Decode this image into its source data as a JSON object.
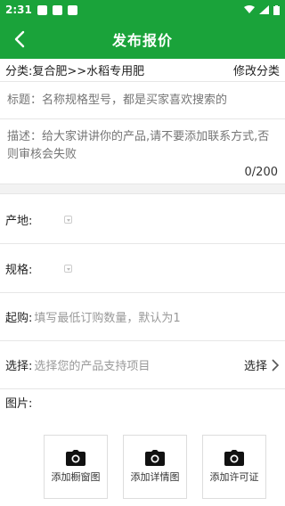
{
  "status_bar": {
    "time": "2:31",
    "left_icons": [
      "image-icon",
      "image-icon",
      "sim-alert-icon"
    ],
    "right_icons": [
      "wifi-icon",
      "signal-icon",
      "battery-icon"
    ]
  },
  "app_bar": {
    "title": "发布报价",
    "back_icon": "back-arrow-icon",
    "color": "#1aa33a"
  },
  "category": {
    "text": "分类:复合肥>>水稻专用肥",
    "modify_label": "修改分类"
  },
  "title_field": {
    "placeholder": "标题：名称规格型号，都是买家喜欢搜索的"
  },
  "description_field": {
    "placeholder": "描述：给大家讲讲你的产品,请不要添加联系方式,否则审核会失败",
    "counter": "0/200"
  },
  "form": {
    "origin_label": "产地:",
    "spec_label": "规格:",
    "moq_label": "起购:",
    "moq_placeholder": "填写最低订购数量，默认为1",
    "options_label": "选择:",
    "options_placeholder": "选择您的产品支持项目",
    "options_action": "选择"
  },
  "pictures": {
    "label": "图片:",
    "tiles": [
      {
        "label": "添加橱窗图"
      },
      {
        "label": "添加详情图"
      },
      {
        "label": "添加许可证"
      }
    ]
  }
}
